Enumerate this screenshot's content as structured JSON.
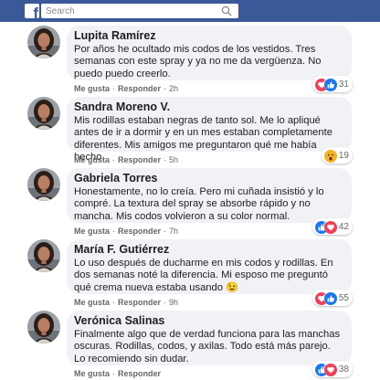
{
  "header": {
    "logo_letter": "f",
    "search_placeholder": "Search",
    "colors": {
      "bar": "#3b5998"
    }
  },
  "actions": {
    "like": "Me gusta",
    "reply": "Responder",
    "separator": "·"
  },
  "comments": [
    {
      "name": "Lupita Ramírez",
      "text": "Por años he ocultado mis codos de los vestidos. Tres semanas con este spray y ya no me da vergüenza. No puedo puedo creerlo.",
      "time": "2h",
      "reactions": [
        "heart-icon",
        "like-icon"
      ],
      "count": "31"
    },
    {
      "name": "Sandra Moreno V.",
      "text": "Mis rodillas estaban negras de tanto sol. Me lo apliqué antes de ir a dormir y en un mes estaban completamente diferentes. Mis amigos me preguntaron qué me había hecho.",
      "time": "5h",
      "reactions": [
        "wow-icon"
      ],
      "count": "19"
    },
    {
      "name": "Gabriela Torres",
      "text": "Honestamente, no lo creía. Pero mi cuñada insistió y lo compré. La textura del spray se absorbe rápido y no mancha. Mis codos volvieron a su color normal.",
      "time": "7h",
      "reactions": [
        "like-icon",
        "heart-icon"
      ],
      "count": "42"
    },
    {
      "name": "María F. Gutiérrez",
      "text": "Lo uso después de ducharme en mis codos y rodillas. En dos semanas noté la diferencia. Mi esposo me preguntó qué crema nueva estaba usando 😉",
      "time": "9h",
      "reactions": [
        "heart-icon",
        "like-icon"
      ],
      "count": "55"
    },
    {
      "name": "Verónica Salinas",
      "text": "Finalmente algo que de verdad funciona para las manchas oscuras. Rodillas, codos, y axilas. Todo está más parejo. Lo recomiendo sin dudar.",
      "time": "",
      "reactions": [
        "like-icon",
        "heart-icon"
      ],
      "count": "38"
    }
  ]
}
